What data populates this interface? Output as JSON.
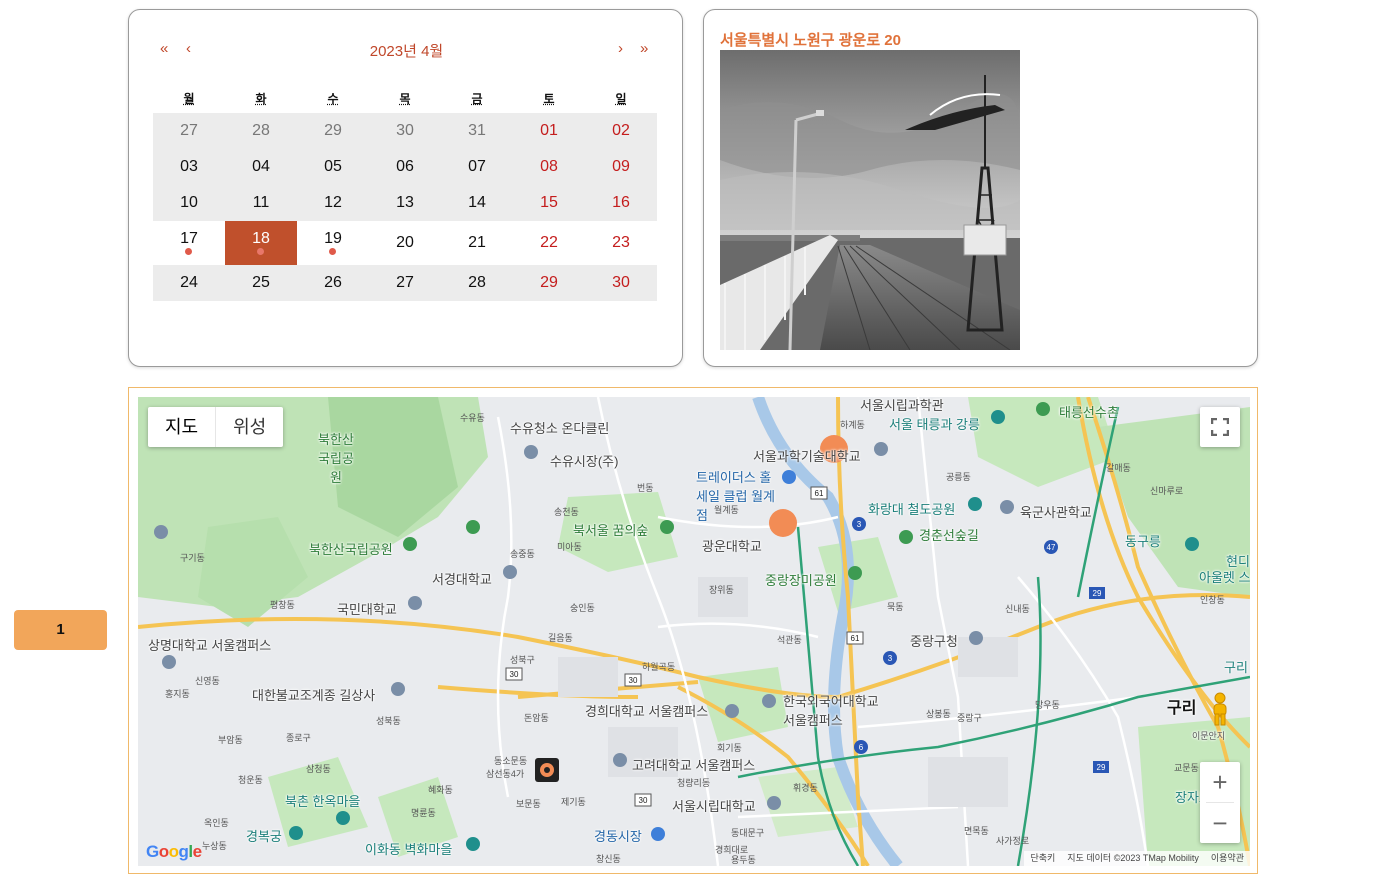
{
  "calendar": {
    "title": "2023년 4월",
    "nav": {
      "prev_year": "«",
      "prev_month": "‹",
      "next_month": "›",
      "next_year": "»"
    },
    "weekdays": [
      "월",
      "화",
      "수",
      "목",
      "금",
      "토",
      "일"
    ],
    "weeks": [
      [
        "27",
        "28",
        "29",
        "30",
        "31",
        "01",
        "02"
      ],
      [
        "03",
        "04",
        "05",
        "06",
        "07",
        "08",
        "09"
      ],
      [
        "10",
        "11",
        "12",
        "13",
        "14",
        "15",
        "16"
      ],
      [
        "17",
        "18",
        "19",
        "20",
        "21",
        "22",
        "23"
      ],
      [
        "24",
        "25",
        "26",
        "27",
        "28",
        "29",
        "30"
      ]
    ],
    "selected": "18",
    "accent_color": "#c0502c",
    "weekend_color": "#c41d1d"
  },
  "photo": {
    "address": "서울특별시 노원구 광운로 20",
    "image": "grayscale-pier-with-lighthouse"
  },
  "side_badge": {
    "label": "1",
    "color": "#f2a65a"
  },
  "map": {
    "type_buttons": {
      "map": "지도",
      "satellite": "위성"
    },
    "zoom_in": "+",
    "zoom_out": "−",
    "labels": {
      "l01": "수유청소 온다클린",
      "l02": "수유시장(주)",
      "l03": "북한산 국립공원",
      "l04": "북한산국립공원",
      "l05": "서경대학교",
      "l06": "국민대학교",
      "l07": "상명대학교 서울캠퍼스",
      "l08": "대한불교조계종 길상사",
      "l09": "북서울 꿈의숲",
      "l10": "광운대학교",
      "l11": "서울과학기술대학교",
      "l12": "트레이더스 홀세일 클럽 월계점",
      "l13": "서울시립과학관",
      "l14": "서울 태릉과 강릉",
      "l15": "태릉선수촌",
      "l16": "화랑대 철도공원",
      "l17": "육군사관학교",
      "l18": "경춘선숲길",
      "l19": "중랑장미공원",
      "l20": "중랑구청",
      "l21": "동구릉",
      "l22": "한국외국어대학교 서울캠퍼스",
      "l23": "경희대학교 서울캠퍼스",
      "l24": "고려대학교 서울캠퍼스",
      "l25": "서울시립대학교",
      "l26": "경동시장",
      "l27": "북촌 한옥마을",
      "l28": "이화동 벽화마을",
      "l29": "경복궁",
      "l30": "구리",
      "l31": "장자호",
      "l32": "아울렛 스",
      "l33": "현디",
      "l34": "구리",
      "l35": "이문안지"
    },
    "small_labels": {
      "s01": "수유동",
      "s02": "구기동",
      "s03": "평창동",
      "s04": "신영동",
      "s05": "홍지동",
      "s06": "부암동",
      "s07": "종로구",
      "s08": "삼청동",
      "s09": "청운동",
      "s10": "옥인동",
      "s11": "누상동",
      "s12": "성북동",
      "s13": "성북구",
      "s14": "길음동",
      "s15": "돈암동",
      "s16": "미아동",
      "s17": "송중동",
      "s18": "송천동",
      "s19": "하월곡동",
      "s20": "장위동",
      "s21": "월계동",
      "s22": "석관동",
      "s23": "하계동",
      "s24": "공릉동",
      "s25": "묵동",
      "s26": "신내동",
      "s27": "망우동",
      "s28": "상봉동",
      "s29": "중랑구",
      "s30": "면목동",
      "s31": "휘경동",
      "s32": "회기동",
      "s33": "청량리동",
      "s34": "용두동",
      "s35": "동대문구",
      "s36": "제기동",
      "s37": "보문동",
      "s38": "명륜동",
      "s39": "혜화동",
      "s40": "창신동",
      "s41": "숭인동",
      "s42": "사가정로",
      "s43": "경희대로",
      "s44": "번동",
      "s45": "인창동",
      "s46": "교문동",
      "s47": "갈매동",
      "s48": "신마루로",
      "s49": "삼선동4가",
      "s50": "동소문동"
    },
    "routes": [
      "61",
      "3",
      "30",
      "47",
      "29",
      "6"
    ],
    "attribution": {
      "shortcuts": "단축키",
      "data": "지도 데이터 ©2023 TMap Mobility",
      "terms": "이용약관"
    },
    "logo": "Google"
  }
}
